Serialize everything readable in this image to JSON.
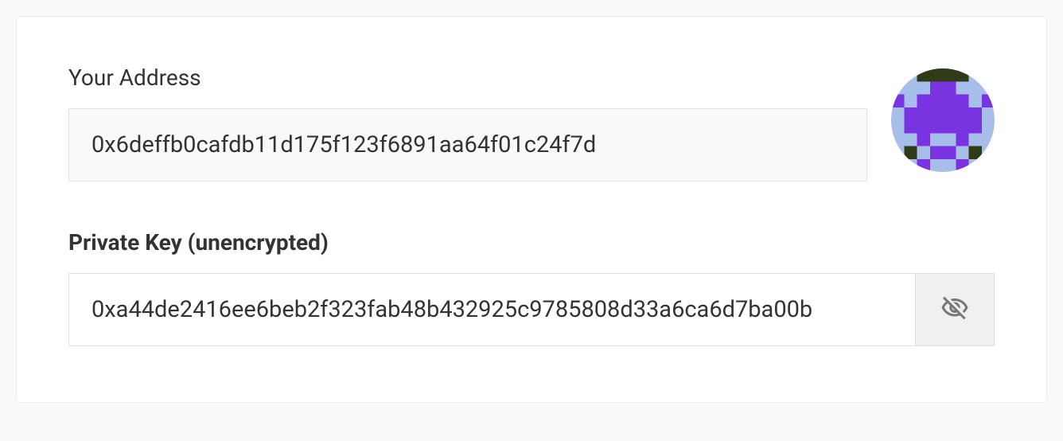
{
  "address": {
    "label": "Your Address",
    "value": "0x6deffb0cafdb11d175f123f6891aa64f01c24f7d"
  },
  "privateKey": {
    "label": "Private Key (unencrypted)",
    "value": "0xa44de2416ee6beb2f323fab48b432925c9785808d33a6ca6d7ba00b"
  },
  "identicon": {
    "colors": {
      "bg": "#a7bdea",
      "primary": "#7933e0",
      "dark": "#2f3b17"
    }
  }
}
